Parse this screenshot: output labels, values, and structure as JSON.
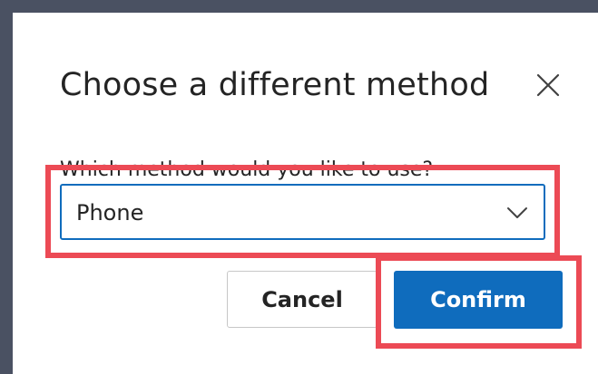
{
  "dialog": {
    "title": "Choose a different method",
    "close_icon": "close-icon",
    "field_label": "Which method would you like to use?",
    "select": {
      "value": "Phone",
      "icon": "chevron-down-icon"
    },
    "buttons": {
      "cancel_label": "Cancel",
      "confirm_label": "Confirm"
    }
  },
  "colors": {
    "backdrop": "#4a5162",
    "accent": "#0f6cbd",
    "highlight": "#ec4a55",
    "text": "#242424"
  }
}
